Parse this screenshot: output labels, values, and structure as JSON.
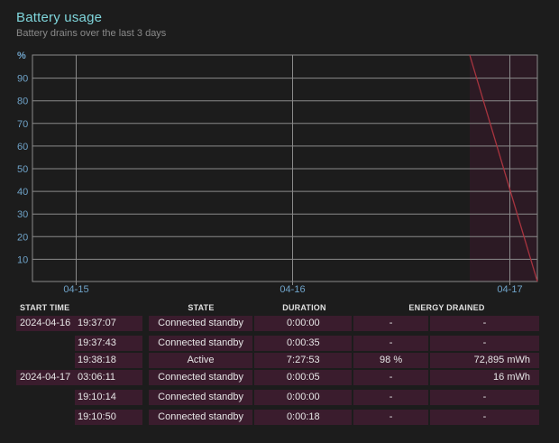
{
  "header": {
    "title": "Battery usage",
    "subtitle": "Battery drains over the last 3 days"
  },
  "colors": {
    "title": "#7fd6dc",
    "axis_label": "#6fa3c9",
    "grid": "#8a8a8a",
    "drain_line": "#a8343f",
    "highlight_band": "#2c1a24",
    "row_bg": "#3a1c2d"
  },
  "chart_data": {
    "type": "line",
    "ylabel": "%",
    "yticks": [
      10,
      20,
      30,
      40,
      50,
      60,
      70,
      80,
      90
    ],
    "ylim": [
      0,
      100
    ],
    "x_ticks": [
      "04-15",
      "04-16",
      "04-17"
    ],
    "series": [
      {
        "values": [
          [
            0,
            100
          ],
          [
            100,
            0
          ]
        ]
      }
    ],
    "grid": true
  },
  "table": {
    "headers": {
      "start_time": "START TIME",
      "state": "STATE",
      "duration": "DURATION",
      "energy": "ENERGY DRAINED"
    },
    "rows": [
      {
        "date": "2024-04-16",
        "time": "19:37:07",
        "state": "Connected standby",
        "duration": "0:00:00",
        "percent": "-",
        "mwh": "-"
      },
      {
        "date": "",
        "time": "19:37:43",
        "state": "Connected standby",
        "duration": "0:00:35",
        "percent": "-",
        "mwh": "-"
      },
      {
        "date": "",
        "time": "19:38:18",
        "state": "Active",
        "duration": "7:27:53",
        "percent": "98 %",
        "mwh": "72,895 mWh"
      },
      {
        "date": "2024-04-17",
        "time": "03:06:11",
        "state": "Connected standby",
        "duration": "0:00:05",
        "percent": "-",
        "mwh": "16 mWh"
      },
      {
        "date": "",
        "time": "19:10:14",
        "state": "Connected standby",
        "duration": "0:00:00",
        "percent": "-",
        "mwh": "-"
      },
      {
        "date": "",
        "time": "19:10:50",
        "state": "Connected standby",
        "duration": "0:00:18",
        "percent": "-",
        "mwh": "-"
      }
    ]
  }
}
